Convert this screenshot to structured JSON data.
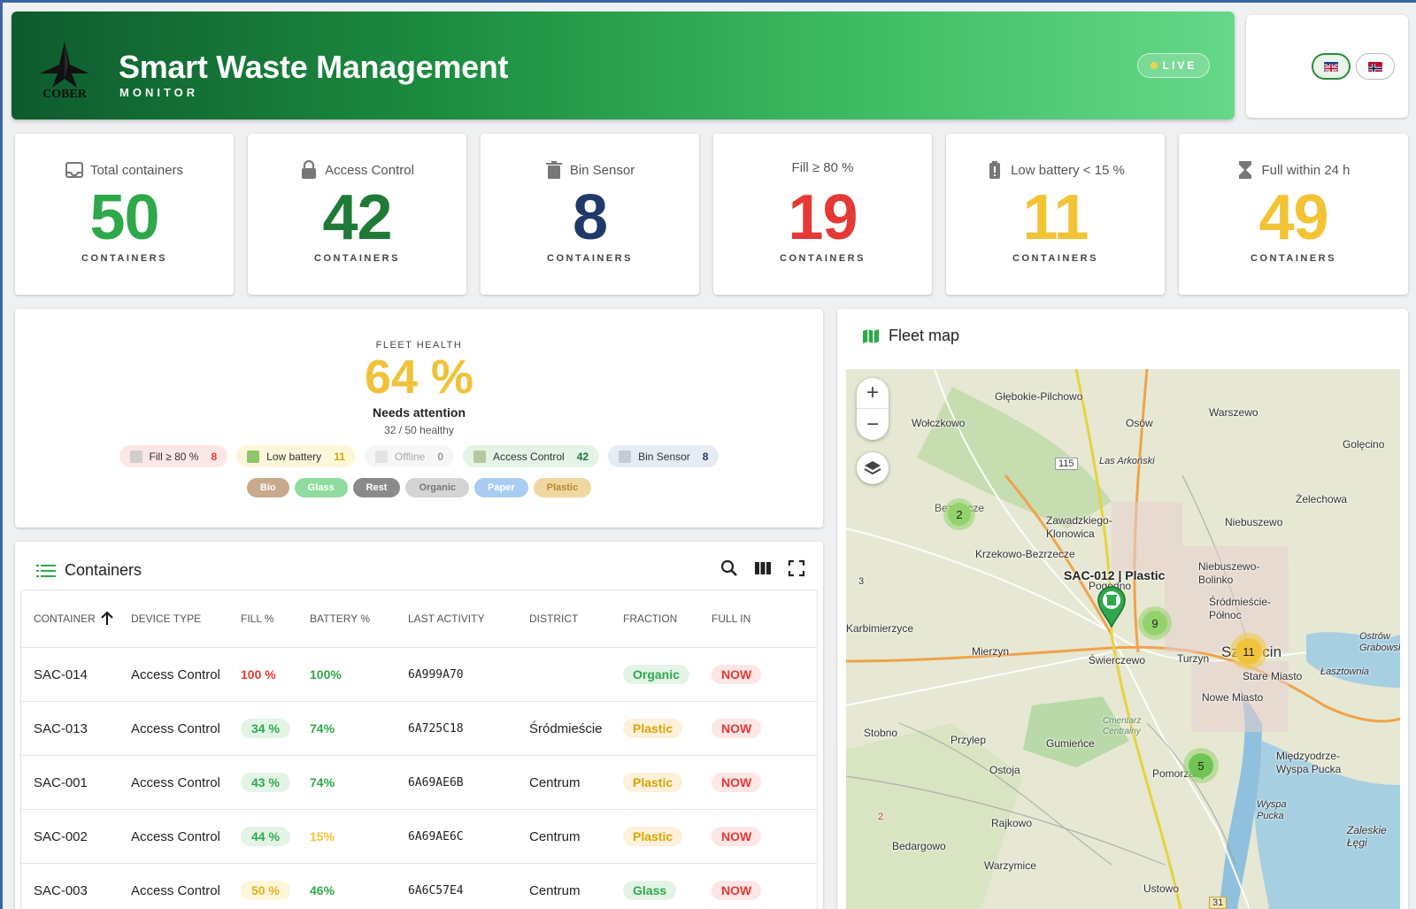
{
  "header": {
    "logo_text": "COBER",
    "title": "Smart Waste Management",
    "subtitle": "MONITOR",
    "live": "LIVE",
    "languages": [
      {
        "code": "en",
        "active": true
      },
      {
        "code": "no",
        "active": false
      }
    ]
  },
  "kpis": [
    {
      "label": "Total containers",
      "value": "50",
      "unit": "CONTAINERS",
      "icon": "inbox-icon",
      "color": "#2ea84a"
    },
    {
      "label": "Access Control",
      "value": "42",
      "unit": "CONTAINERS",
      "icon": "lock-icon",
      "color": "#1f7a35"
    },
    {
      "label": "Bin Sensor",
      "value": "8",
      "unit": "CONTAINERS",
      "icon": "trash-icon",
      "color": "#1f3a68"
    },
    {
      "label": "Fill ≥ 80 %",
      "value": "19",
      "unit": "CONTAINERS",
      "icon": "",
      "color": "#e53935"
    },
    {
      "label": "Low battery < 15 %",
      "value": "11",
      "unit": "CONTAINERS",
      "icon": "battery-alert-icon",
      "color": "#f2c335"
    },
    {
      "label": "Full within 24 h",
      "value": "49",
      "unit": "CONTAINERS",
      "icon": "hourglass-icon",
      "color": "#f2c335"
    }
  ],
  "fleet_health": {
    "label": "FLEET HEALTH",
    "value": "64 %",
    "status": "Needs attention",
    "healthy": "32 / 50 healthy",
    "chips": [
      {
        "label": "Fill ≥ 80 %",
        "count": "8",
        "bg": "#fde6e6",
        "color": "#e53935"
      },
      {
        "label": "Low battery",
        "count": "11",
        "bg": "#fdf6d8",
        "color": "#d9a400"
      },
      {
        "label": "Offline",
        "count": "0",
        "bg": "#f4f4f4",
        "color": "#999"
      },
      {
        "label": "Access Control",
        "count": "42",
        "bg": "#e3f4e6",
        "color": "#1f7a35"
      },
      {
        "label": "Bin Sensor",
        "count": "8",
        "bg": "#e6ecf4",
        "color": "#1f3a68"
      }
    ],
    "fractions": [
      {
        "label": "Bio",
        "bg": "#c8a98b"
      },
      {
        "label": "Glass",
        "bg": "#8fdc9c"
      },
      {
        "label": "Rest",
        "bg": "#8a8a8a"
      },
      {
        "label": "Organic",
        "bg": "#cfcfcf",
        "color": "#666"
      },
      {
        "label": "Paper",
        "bg": "#a9cdf2"
      },
      {
        "label": "Plastic",
        "bg": "#efd7a1",
        "color": "#b88a2a"
      }
    ]
  },
  "containers": {
    "title": "Containers",
    "columns": [
      "CONTAINER",
      "DEVICE TYPE",
      "FILL %",
      "BATTERY %",
      "LAST ACTIVITY",
      "DISTRICT",
      "FRACTION",
      "FULL IN"
    ],
    "rows": [
      {
        "id": "SAC-014",
        "type": "Access Control",
        "fill": "100 %",
        "fill_style": "red",
        "battery": "100%",
        "battery_color": "#2ea84a",
        "activity": "6A999A70",
        "district": "",
        "fraction": "Organic",
        "fraction_style": "green",
        "full_in": "NOW"
      },
      {
        "id": "SAC-013",
        "type": "Access Control",
        "fill": "34 %",
        "fill_style": "green",
        "battery": "74%",
        "battery_color": "#2ea84a",
        "activity": "6A725C18",
        "district": "Śródmieście",
        "fraction": "Plastic",
        "fraction_style": "amber",
        "full_in": "NOW"
      },
      {
        "id": "SAC-001",
        "type": "Access Control",
        "fill": "43 %",
        "fill_style": "green",
        "battery": "74%",
        "battery_color": "#2ea84a",
        "activity": "6A69AE6B",
        "district": "Centrum",
        "fraction": "Plastic",
        "fraction_style": "amber",
        "full_in": "NOW"
      },
      {
        "id": "SAC-002",
        "type": "Access Control",
        "fill": "44 %",
        "fill_style": "green",
        "battery": "15%",
        "battery_color": "#f2c335",
        "activity": "6A69AE6C",
        "district": "Centrum",
        "fraction": "Plastic",
        "fraction_style": "amber",
        "full_in": "NOW"
      },
      {
        "id": "SAC-003",
        "type": "Access Control",
        "fill": "50 %",
        "fill_style": "yellow",
        "battery": "46%",
        "battery_color": "#2ea84a",
        "activity": "6A6C57E4",
        "district": "Centrum",
        "fraction": "Glass",
        "fraction_style": "green",
        "full_in": "NOW"
      }
    ]
  },
  "map": {
    "title": "Fleet map",
    "zoom_in": "+",
    "zoom_out": "−",
    "marker_label": "SAC-012 | Plastic",
    "clusters": [
      {
        "count": "2"
      },
      {
        "count": "9"
      },
      {
        "count": "11"
      },
      {
        "count": "5"
      }
    ],
    "places": [
      "Głębokie-Pilchowo",
      "Wołczkowo",
      "Osów",
      "Warszewo",
      "Golęcino",
      "Las Arkoński",
      "115",
      "Żelechowa",
      "Zawadzkiego-Klonowica",
      "Niebuszewo",
      "Krzekowo-Bezrzecze",
      "Niebuszewo-Bolinko",
      "Pogodno",
      "Śródmieście-Północ",
      "Karbimierzyce",
      "Mierzyn",
      "Świerczewo",
      "Turzyn",
      "Szczecin",
      "Ostrów Grabowski",
      "Stare Miasto",
      "Łasztownia",
      "Nowe Miasto",
      "Stobno",
      "Przylep",
      "Gumieńce",
      "Cmentarz Centralny",
      "Międzyodrze-Wyspa Pucka",
      "Ostoja",
      "Pomorzany",
      "Wyspa Pucka",
      "Zaleskie Łęgi",
      "Rajkowo",
      "Bezrzecze",
      "Bedargowo",
      "Warzymice",
      "Ustowo",
      "31",
      "2",
      "3"
    ]
  }
}
